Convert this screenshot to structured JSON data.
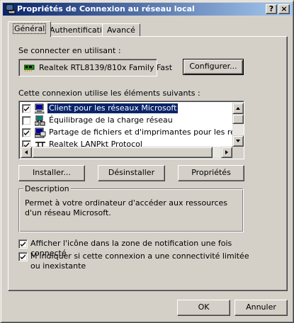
{
  "window": {
    "title": "Propriétés de Connexion au réseau local",
    "help_label": "?",
    "close_label": "×"
  },
  "tabs": [
    {
      "label": "Général",
      "active": true
    },
    {
      "label": "Authentification",
      "active": false
    },
    {
      "label": "Avancé",
      "active": false
    }
  ],
  "connect": {
    "label": "Se connecter en utilisant :",
    "adapter": "Realtek RTL8139/810x Family Fast",
    "configure_label": "Configurer..."
  },
  "components": {
    "label": "Cette connexion utilise les éléments suivants :",
    "items": [
      {
        "label": "Client pour les réseaux Microsoft",
        "checked": true,
        "selected": true,
        "icon": "network-client-icon"
      },
      {
        "label": "Équilibrage de la charge réseau",
        "checked": false,
        "selected": false,
        "icon": "network-service-icon"
      },
      {
        "label": "Partage de fichiers et d'imprimantes pour les réseaux M",
        "checked": true,
        "selected": false,
        "icon": "file-printer-sharing-icon"
      },
      {
        "label": "Realtek LANPkt Protocol",
        "checked": true,
        "selected": false,
        "icon": "protocol-icon"
      }
    ]
  },
  "actions": {
    "install_label": "Installer...",
    "uninstall_label": "Désinstaller",
    "properties_label": "Propriétés"
  },
  "description": {
    "title": "Description",
    "text": "Permet à votre ordinateur d'accéder aux ressources d'un réseau Microsoft."
  },
  "options": [
    {
      "label": "Afficher l'icône dans la zone de notification une fois connecté",
      "checked": true
    },
    {
      "label": "M'indiquer si cette connexion a une connectivité limitée ou inexistante",
      "checked": true
    }
  ],
  "footer": {
    "ok_label": "OK",
    "cancel_label": "Annuler"
  }
}
